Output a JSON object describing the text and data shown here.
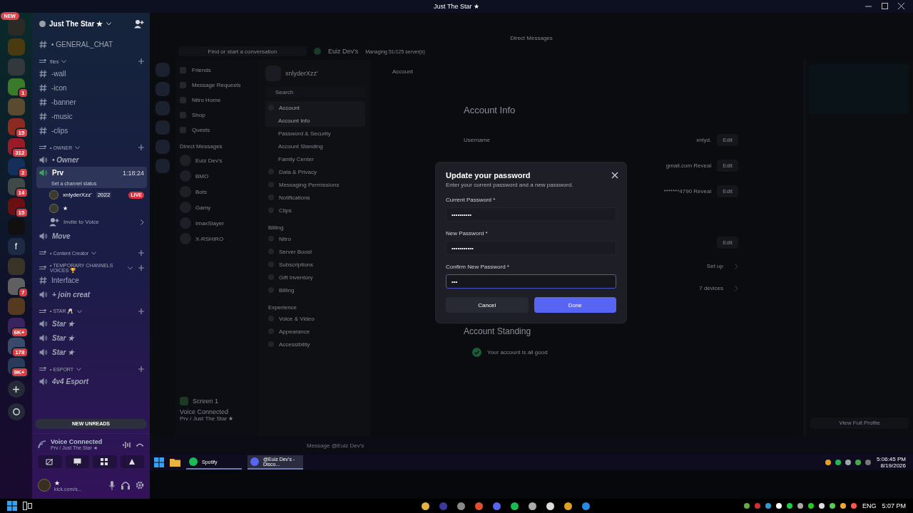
{
  "window": {
    "title": "Just The Star ★"
  },
  "servers": [
    {
      "kind": "server",
      "pill": "NEW"
    },
    {
      "kind": "server"
    },
    {
      "kind": "server"
    },
    {
      "kind": "server",
      "badge": "1"
    },
    {
      "kind": "server"
    },
    {
      "kind": "server",
      "badge": "15"
    },
    {
      "kind": "server",
      "badge": "312"
    },
    {
      "kind": "server",
      "badge": "2"
    },
    {
      "kind": "server",
      "badge": "14"
    },
    {
      "kind": "server",
      "badge": "15"
    },
    {
      "kind": "server"
    },
    {
      "kind": "server",
      "label": "f"
    },
    {
      "kind": "server"
    },
    {
      "kind": "server",
      "badge": "7"
    },
    {
      "kind": "server"
    },
    {
      "kind": "server",
      "badge": "6K+"
    },
    {
      "kind": "server",
      "badge": "178"
    },
    {
      "kind": "server",
      "badge": "9K+"
    }
  ],
  "server": {
    "name": "Just The Star ★"
  },
  "channels": [
    {
      "kind": "text",
      "name": "• GENERAL_CHAT",
      "selected": false
    },
    {
      "kind": "category",
      "name": "files"
    },
    {
      "kind": "text",
      "name": "-wall",
      "selected": false
    },
    {
      "kind": "text",
      "name": "-icon",
      "selected": false
    },
    {
      "kind": "text",
      "name": "-banner",
      "selected": false
    },
    {
      "kind": "text",
      "name": "-music",
      "selected": false
    },
    {
      "kind": "text",
      "name": "-clips",
      "selected": false
    },
    {
      "kind": "category",
      "name": "• OWNER"
    },
    {
      "kind": "voice",
      "name": "• Owner",
      "selected": false
    },
    {
      "kind": "voice",
      "name": "Prv",
      "selected": true,
      "time": "1:18:24",
      "status": "Set a channel status"
    },
    {
      "kind": "member",
      "name": "xnlyderXzz'",
      "tag": "2022",
      "live": "LIVE"
    },
    {
      "kind": "member",
      "name": "★"
    },
    {
      "kind": "invite",
      "name": "Invite to Voice"
    },
    {
      "kind": "voice",
      "name": "Move",
      "selected": false
    },
    {
      "kind": "category",
      "name": "• Content Creator"
    },
    {
      "kind": "category",
      "name": "• TEMPORARY CHANNELS VOICES 🏆"
    },
    {
      "kind": "text",
      "name": "Interface",
      "selected": false
    },
    {
      "kind": "voice",
      "name": "+ join creat",
      "selected": false
    },
    {
      "kind": "category",
      "name": "• STAR 🥂"
    },
    {
      "kind": "voice",
      "name": "Star ★",
      "selected": false
    },
    {
      "kind": "voice",
      "name": "Star ★",
      "selected": false
    },
    {
      "kind": "voice",
      "name": "Star ★",
      "selected": false
    },
    {
      "kind": "category",
      "name": "• ESPORT"
    },
    {
      "kind": "voice",
      "name": "4v4 Esport",
      "selected": false
    }
  ],
  "new_unreads": "NEW UNREADS",
  "voice_panel": {
    "title": "Voice Connected",
    "subtitle": "Prv / Just The Star ★"
  },
  "user_panel": {
    "name": "★",
    "status": "kick.com/s..."
  },
  "background": {
    "header": "Direct Messages",
    "search": "Find or start a conversation",
    "dm_title": "Euiz Dev's",
    "dm_subtitle": "Managing 51/125 server(s)",
    "nav": [
      "Friends",
      "Message Requests",
      "Nitro Home",
      "Shop",
      "Quests"
    ],
    "dm_heading": "Direct Messages",
    "dms": [
      "Euiz Dev's",
      "BMO",
      "Bots",
      "Gamy",
      "ImaxSlayer",
      "X-RSHIRO"
    ],
    "screen": "Screen 1",
    "voice": "Voice Connected",
    "voice_sub": "Prv / Just The Star ★",
    "settings_user": "xnlyderXzz'",
    "settings_search": "Search",
    "settings": [
      {
        "label": "Account",
        "kind": "section",
        "selected": true
      },
      {
        "label": "Account Info",
        "kind": "sub",
        "selected": true
      },
      {
        "label": "Password & Security",
        "kind": "sub",
        "selected": false
      },
      {
        "label": "Account Standing",
        "kind": "sub",
        "selected": false
      },
      {
        "label": "Family Center",
        "kind": "sub",
        "selected": false
      },
      {
        "label": "Data & Privacy",
        "kind": "section",
        "selected": false
      },
      {
        "label": "Messaging Permissions",
        "kind": "section",
        "selected": false
      },
      {
        "label": "Notifications",
        "kind": "section",
        "selected": false
      },
      {
        "label": "Clips",
        "kind": "section",
        "selected": false
      },
      {
        "label": "Billing",
        "kind": "heading"
      },
      {
        "label": "Nitro",
        "kind": "section",
        "selected": false
      },
      {
        "label": "Server Boost",
        "kind": "section",
        "selected": false
      },
      {
        "label": "Subscriptions",
        "kind": "section",
        "selected": false
      },
      {
        "label": "Gift Inventory",
        "kind": "section",
        "selected": false
      },
      {
        "label": "Billing",
        "kind": "section",
        "selected": false
      },
      {
        "label": "Experience",
        "kind": "heading"
      },
      {
        "label": "Voice & Video",
        "kind": "section",
        "selected": false
      },
      {
        "label": "Appearance",
        "kind": "section",
        "selected": false
      },
      {
        "label": "Accessibility",
        "kind": "section",
        "selected": false
      }
    ],
    "page_title": "Account",
    "section_title": "Account Info",
    "rows": [
      {
        "kind": "edit",
        "label": "Username",
        "value": "xnlyd.",
        "action": "Edit"
      },
      {
        "kind": "edit",
        "value": "gmail.com Reveal",
        "action": "Edit"
      },
      {
        "kind": "edit",
        "value": "*******4790 Reveal",
        "action": "Edit"
      },
      {
        "kind": "blank"
      },
      {
        "kind": "edit",
        "action": "Edit"
      },
      {
        "kind": "link",
        "action": "Set up"
      },
      {
        "kind": "link",
        "action": "7 devices"
      }
    ],
    "standing_title": "Account Standing",
    "standing_text": "Your account is all good",
    "message_placeholder": "Message @Euiz Dev's",
    "profile_button": "View Full Profile"
  },
  "dialog": {
    "title": "Update your password",
    "subtitle": "Enter your current password and a new password.",
    "fields": [
      {
        "label": "Current Password *",
        "value": "••••••••••",
        "focused": false
      },
      {
        "label": "New Password *",
        "value": "•••••••••••",
        "focused": false
      },
      {
        "label": "Confirm New Password *",
        "value": "•••",
        "focused": true
      }
    ],
    "cancel": "Cancel",
    "done": "Done"
  },
  "inner_taskbar": {
    "apps": [
      {
        "name": "Spotify",
        "kind": "spotify",
        "selected": false
      },
      {
        "name": "@Euiz Dev's - Disco...",
        "kind": "discord",
        "selected": true
      }
    ],
    "time": "5:06:45 PM",
    "date": "8/19/2026"
  },
  "taskbar": {
    "language": "ENG",
    "time": "5:07 PM"
  }
}
